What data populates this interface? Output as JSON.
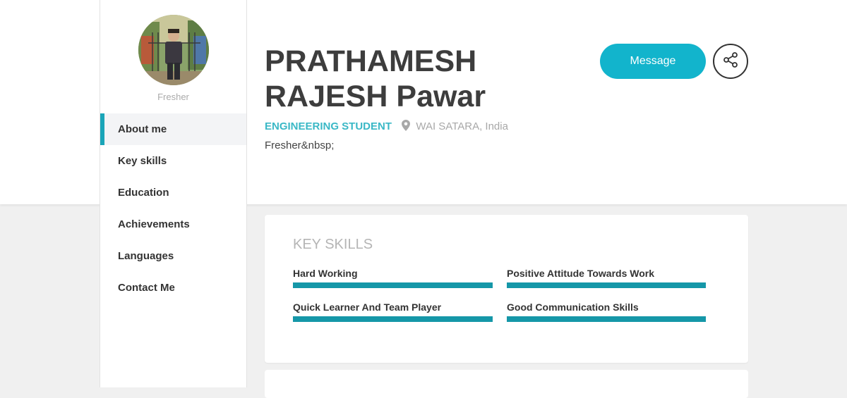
{
  "profile": {
    "tag": "Fresher",
    "name": "PRATHAMESH RAJESH Pawar",
    "role": "ENGINEERING STUDENT",
    "location": "WAI SATARA, India",
    "summary": "Fresher&nbsp;"
  },
  "nav": {
    "items": [
      {
        "label": "About me",
        "active": true
      },
      {
        "label": "Key skills",
        "active": false
      },
      {
        "label": "Education",
        "active": false
      },
      {
        "label": "Achievements",
        "active": false
      },
      {
        "label": "Languages",
        "active": false
      },
      {
        "label": "Contact Me",
        "active": false
      }
    ]
  },
  "actions": {
    "message_label": "Message",
    "share_icon": "share-icon"
  },
  "key_skills": {
    "title": "KEY SKILLS",
    "skills": [
      {
        "name": "Hard Working",
        "level": 1.0
      },
      {
        "name": "Positive Attitude Towards Work",
        "level": 1.0
      },
      {
        "name": "Quick Learner And Team Player",
        "level": 1.0
      },
      {
        "name": "Good Communication Skills",
        "level": 1.0
      }
    ]
  },
  "colors": {
    "accent": "#12b4cc",
    "skill_bar": "#1597a8",
    "role_text": "#3ab8c6"
  }
}
